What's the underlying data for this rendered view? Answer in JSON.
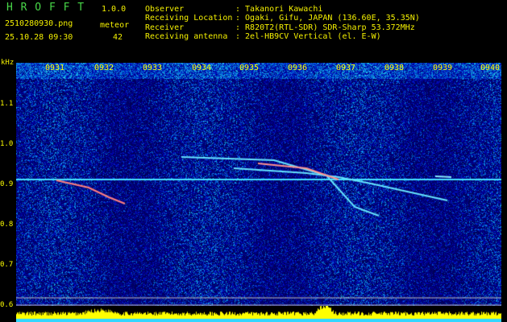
{
  "app": {
    "logo": "H R O F F T",
    "version": "1.0.0",
    "filename": "2510280930.png",
    "timestamp": "25.10.28 09:30",
    "meteor_label": "meteor",
    "meteor_count": "42"
  },
  "info": {
    "observer_label": "Observer",
    "observer_value": ": Takanori Kawachi",
    "location_label": "Receiving Location",
    "location_value": ": Ogaki, Gifu, JAPAN (136.60E, 35.35N)",
    "receiver_label": "Receiver",
    "receiver_value": ": R820T2(RTL-SDR) SDR-Sharp 53.372MHz",
    "antenna_label": "Receiving antenna",
    "antenna_value": ": 2el-HB9CV Vertical (el. E-W)"
  },
  "axis": {
    "unit": "kHz",
    "y_ticks": [
      "1.1",
      "1.0",
      "0.9",
      "0.8",
      "0.7",
      "0.6"
    ],
    "x_ticks": [
      "0931",
      "0932",
      "0933",
      "0934",
      "0935",
      "0936",
      "0937",
      "0938",
      "0939",
      "0940"
    ]
  },
  "colors": {
    "background": "#000000",
    "spectrum_base": "#000a8c",
    "carrier_line": "#44e0ff",
    "text_header": "#ffffff",
    "logo_green": "#48d848",
    "label_yellow": "#f4f000",
    "strip_yellow": "#ffff00",
    "strip_cyan": "#33d6ff"
  }
}
